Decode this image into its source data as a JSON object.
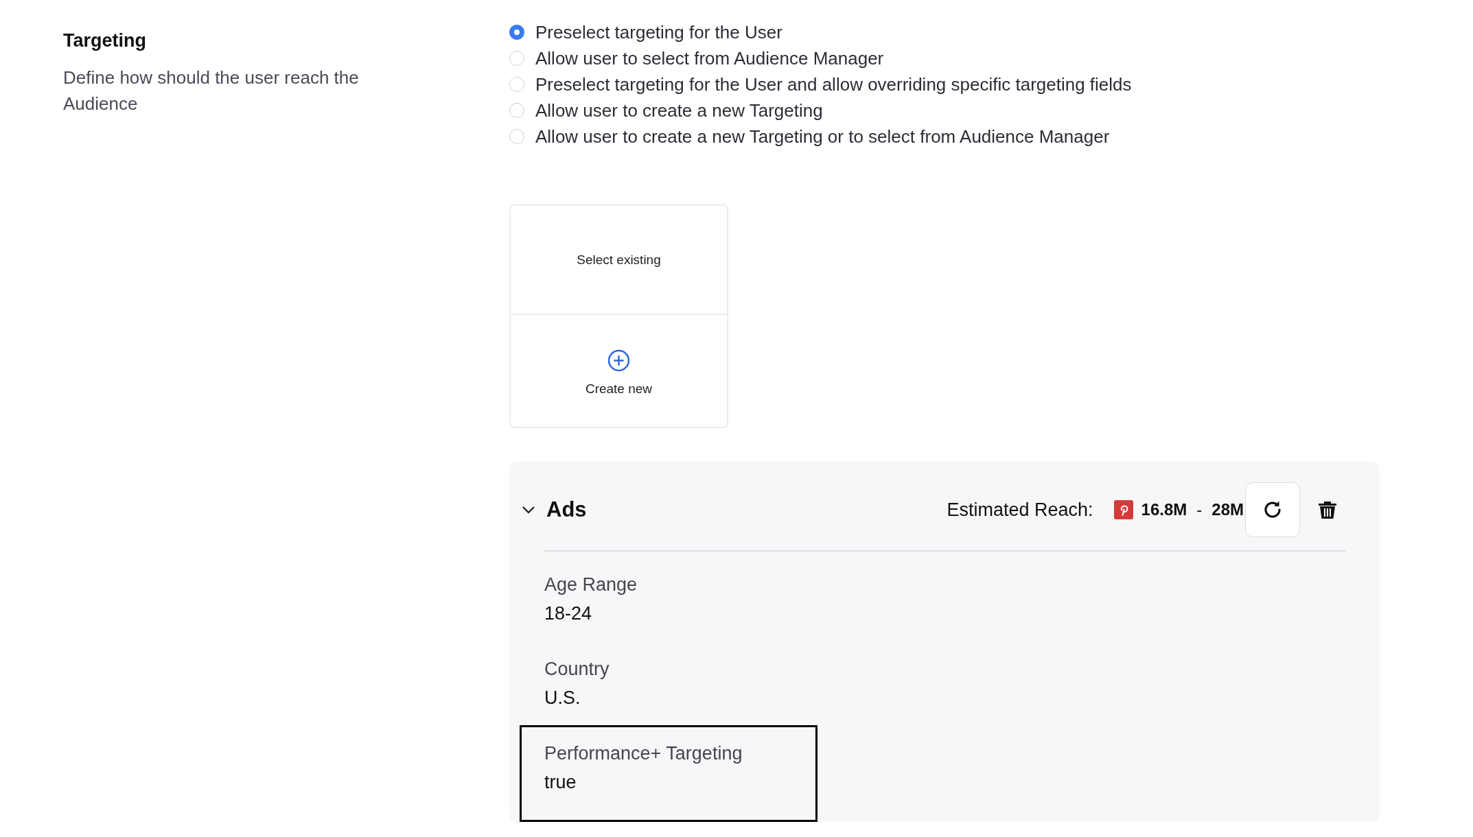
{
  "section": {
    "title": "Targeting",
    "description": "Define how should the user reach the Audience"
  },
  "targeting_options": [
    {
      "label": "Preselect targeting for the User",
      "selected": true
    },
    {
      "label": "Allow user to select from Audience Manager",
      "selected": false
    },
    {
      "label": "Preselect targeting for the User and allow overriding specific targeting fields",
      "selected": false
    },
    {
      "label": "Allow user to create a new Targeting",
      "selected": false
    },
    {
      "label": "Allow user to create a new Targeting or to select from Audience Manager",
      "selected": false
    }
  ],
  "choice_card": {
    "options": [
      {
        "kind": "select",
        "label": "Select existing"
      },
      {
        "kind": "create",
        "label": "Create new"
      }
    ]
  },
  "ads_panel": {
    "title": "Ads",
    "expanded": true,
    "estimated_reach": {
      "label": "Estimated Reach:",
      "min": "16.8M",
      "separator": "-",
      "max": "28M"
    },
    "fields": [
      {
        "label": "Age Range",
        "value": "18-24",
        "highlighted": false
      },
      {
        "label": "Country",
        "value": "U.S.",
        "highlighted": false
      },
      {
        "label": "Performance+ Targeting",
        "value": "true",
        "highlighted": true
      }
    ]
  }
}
